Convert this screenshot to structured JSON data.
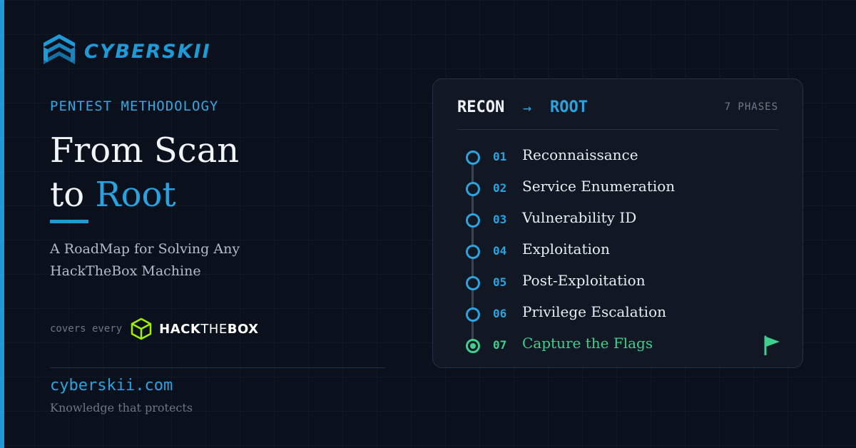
{
  "brand": {
    "name": "CYBERSKII"
  },
  "colors": {
    "accent": "#1e9bd7",
    "success": "#3ecf8e",
    "background": "#0b111c",
    "card": "#111823"
  },
  "hero": {
    "eyebrow": "PENTEST METHODOLOGY",
    "title_line1": "From Scan",
    "title_line2_prefix": "to",
    "title_line2_highlight": "Root",
    "tagline_line1": "A RoadMap for Solving Any",
    "tagline_line2": "HackTheBox Machine"
  },
  "coverage": {
    "label": "covers every",
    "platform_bold": "HACK",
    "platform_thin": "THE",
    "platform_bold2": "BOX",
    "icon": "cube-icon"
  },
  "footer": {
    "url": "cyberskii.com",
    "motto": "Knowledge that protects"
  },
  "roadmap": {
    "from": "RECON",
    "arrow": "→",
    "to": "ROOT",
    "count_label": "7 PHASES",
    "phases": [
      {
        "num": "01",
        "name": "Reconnaissance"
      },
      {
        "num": "02",
        "name": "Service Enumeration"
      },
      {
        "num": "03",
        "name": "Vulnerability ID"
      },
      {
        "num": "04",
        "name": "Exploitation"
      },
      {
        "num": "05",
        "name": "Post-Exploitation"
      },
      {
        "num": "06",
        "name": "Privilege Escalation"
      },
      {
        "num": "07",
        "name": "Capture the Flags",
        "final": true,
        "icon": "flag-icon"
      }
    ]
  }
}
